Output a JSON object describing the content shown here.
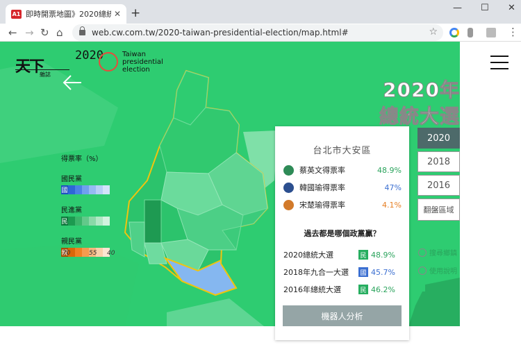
{
  "browser": {
    "tab_title": "即時開票地圖》2020總統大選",
    "favicon_text": "A1",
    "new_tab": "+",
    "url": "web.cw.com.tw/2020-taiwan-presidential-election/map.html#",
    "buttons": {
      "minimize": "—",
      "maximize": "☐",
      "close": "✕",
      "back": "←",
      "forward": "→",
      "reload": "↻",
      "home": "⌂",
      "star": "☆",
      "menu": "⋮"
    }
  },
  "site": {
    "logo_chinese": "天下",
    "logo_small": "雜誌",
    "logo_year": "2020",
    "logo_english": [
      "Taiwan",
      "presidential",
      "election"
    ],
    "title_line1": "2020年",
    "title_line2": "總統大選"
  },
  "year_tabs": [
    "2020",
    "2018",
    "2016",
    "翻盤區域"
  ],
  "side_options": [
    "搜尋鄉鎮",
    "使用說明"
  ],
  "legend": {
    "title": "得票率（%）",
    "parties": [
      {
        "name": "國民黨",
        "label": "國",
        "colors": [
          "#1b4fbf",
          "#2e67d6",
          "#4a82e6",
          "#6fa0ee",
          "#95baf3",
          "#b6d0f7",
          "#d3e3fa"
        ]
      },
      {
        "name": "民進黨",
        "label": "民",
        "colors": [
          "#0e7a3d",
          "#1c9a50",
          "#3bb56a",
          "#62c98a",
          "#8ad9a8",
          "#b1e8c5",
          "#d2f3df"
        ]
      },
      {
        "name": "親民黨",
        "label": "親",
        "colors": [
          "#a84e05",
          "#d9670a",
          "#ee8124",
          "#f49b4f",
          "#f7b77f",
          "#fad1ab",
          "#fde5d2"
        ]
      }
    ],
    "ticks": [
      "70",
      "55",
      "40"
    ]
  },
  "panel": {
    "district": "台北市大安區",
    "candidates": [
      {
        "name": "蔡英文得票率",
        "pct": "48.9%",
        "color": "#2aa35c"
      },
      {
        "name": "韓國瑜得票率",
        "pct": "47%",
        "color": "#3b6fd1"
      },
      {
        "name": "宋楚瑜得票率",
        "pct": "4.1%",
        "color": "#e67e22"
      }
    ],
    "question": "過去都是哪個政黨贏？",
    "history": [
      {
        "election": "2020總統大選",
        "party": "民",
        "value": "48.9%",
        "color": "#2aa35c",
        "badge": "#27ae60"
      },
      {
        "election": "2018年九合一大選",
        "party": "國",
        "value": "45.7%",
        "color": "#3b6fd1",
        "badge": "#3b6fd1"
      },
      {
        "election": "2016年總統大選",
        "party": "民",
        "value": "46.2%",
        "color": "#2aa35c",
        "badge": "#27ae60"
      }
    ],
    "robot_button": "機器人分析"
  },
  "colors": {
    "map_base": "#2ecc71",
    "boundary": "#f1c40f",
    "selected_district": "#85b7f0"
  }
}
